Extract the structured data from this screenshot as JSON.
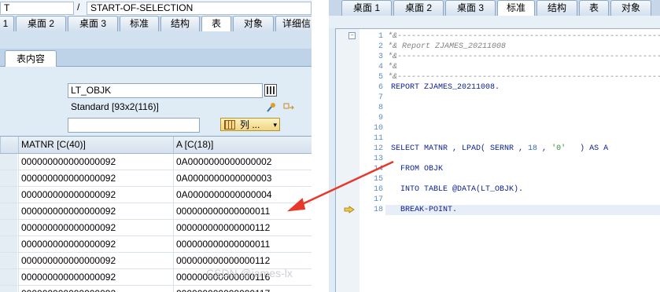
{
  "left": {
    "titlebar": {
      "field1": "T",
      "separator": "/",
      "field2": "START-OF-SELECTION"
    },
    "tabs": [
      "1",
      "桌面 2",
      "桌面 3",
      "标准",
      "结构",
      "表",
      "对象",
      "详细信"
    ],
    "active_tab": "表",
    "subtab": "表内容",
    "table_name": "LT_OBJK",
    "table_info": "Standard [93x2(116)]",
    "filter_value": "",
    "columns_button": "列 ...",
    "grid": {
      "headers": [
        "MATNR [C(40)]",
        "A [C(18)]"
      ],
      "rows": [
        [
          "000000000000000092",
          "0A0000000000000002"
        ],
        [
          "000000000000000092",
          "0A0000000000000003"
        ],
        [
          "000000000000000092",
          "0A0000000000000004"
        ],
        [
          "000000000000000092",
          "000000000000000011"
        ],
        [
          "000000000000000092",
          "000000000000000112"
        ],
        [
          "000000000000000092",
          "000000000000000011"
        ],
        [
          "000000000000000092",
          "000000000000000112"
        ],
        [
          "000000000000000092",
          "000000000000000116"
        ],
        [
          "000000000000000092",
          "000000000000000117"
        ]
      ]
    }
  },
  "right": {
    "tabs": [
      "桌面 1",
      "桌面 2",
      "桌面 3",
      "标准",
      "结构",
      "表",
      "对象"
    ],
    "active_tab": "标准",
    "line_numbers": [
      "1",
      "2",
      "3",
      "4",
      "5",
      "6",
      "7",
      "8",
      "9",
      "10",
      "11",
      "12",
      "13",
      "14",
      "15",
      "16",
      "17",
      "18"
    ],
    "code": {
      "l1": "*&---------------------------------------------------------",
      "l2": "*& Report ZJAMES_20211008",
      "l3": "*&---------------------------------------------------------",
      "l4": "*&",
      "l5": "*&---------------------------------------------------------",
      "l6": "REPORT ZJAMES_20211008.",
      "l12_a": "SELECT MATNR , LPAD( SERNR , ",
      "l12_num": "18",
      "l12_b": " , ",
      "l12_str": "'0'",
      "l12_c": "   ) AS A",
      "l13": "  FROM OBJK",
      "l15": "  INTO TABLE @DATA(LT_OBJK).",
      "l18": "  BREAK-POINT."
    },
    "current_line": "18"
  },
  "watermark": "CSDN @james-lx",
  "colors": {
    "accent": "#e8382a",
    "keyword": "#0a1f8c",
    "comment": "#808080"
  }
}
